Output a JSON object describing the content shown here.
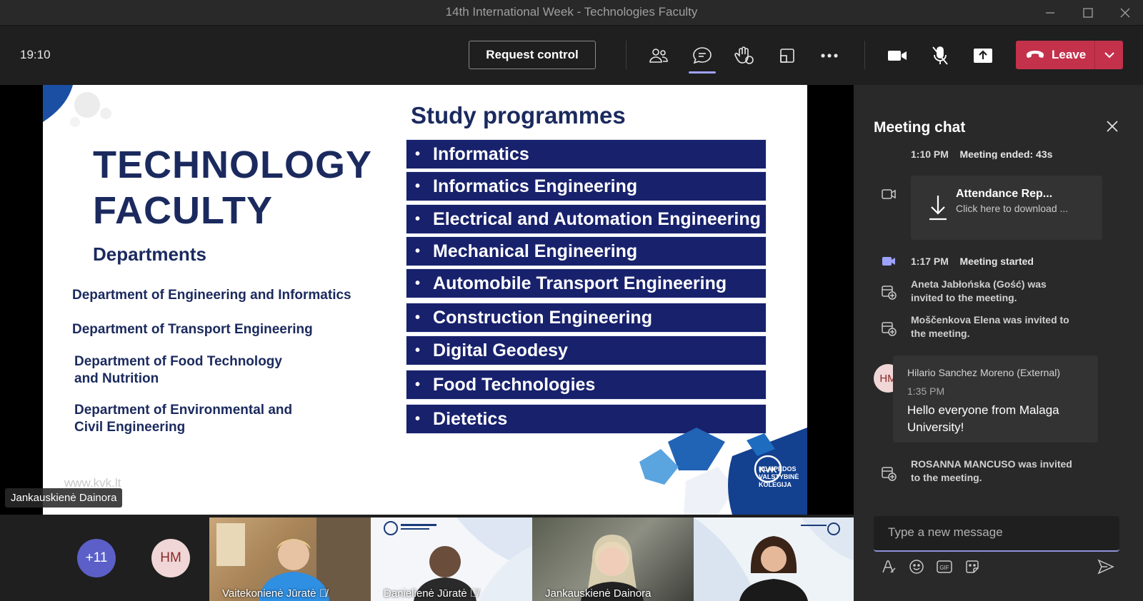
{
  "window": {
    "title": "14th International Week - Technologies Faculty"
  },
  "toolbar": {
    "clock": "19:10",
    "request_control_label": "Request control",
    "leave_label": "Leave"
  },
  "slide": {
    "title_line1": "TECHNOLOGY",
    "title_line2": "FACULTY",
    "departments_heading": "Departments",
    "departments": [
      "Department of Engineering and Informatics",
      "Department of Transport Engineering",
      "Department of Food Technology and Nutrition",
      "Department of Environmental and Civil Engineering"
    ],
    "programmes_heading": "Study programmes",
    "programmes": [
      "Informatics",
      "Informatics Engineering",
      "Electrical and Automation Engineering",
      "Mechanical Engineering",
      "Automobile Transport Engineering",
      "Construction Engineering",
      "Digital Geodesy",
      "Food Technologies",
      "Dietetics"
    ],
    "bullet": "•",
    "website": "www.kvk.lt",
    "logo_mark": "KVK",
    "logo_text": [
      "KLAIPĖDOS",
      "VALSTYBINĖ",
      "KOLEGIJA"
    ],
    "presenter_name": "Jankauskienė Dainora"
  },
  "participants": {
    "overflow_count": "+11",
    "initials_avatar": "HM",
    "tiles": [
      {
        "name": "Vaitekonienė Jūratė",
        "muted": true
      },
      {
        "name": "Danielienė Jūratė",
        "muted": true
      },
      {
        "name": "Jankauskienė Dainora",
        "muted": false
      },
      {
        "name": "",
        "muted": false
      }
    ]
  },
  "chat": {
    "title": "Meeting chat",
    "events": [
      {
        "time": "1:10 PM",
        "text": "Meeting ended: 43s"
      },
      {
        "time": "1:17 PM",
        "text": "Meeting started"
      }
    ],
    "attendance": {
      "title": "Attendance Rep...",
      "subtitle": "Click here to download ..."
    },
    "invites": [
      "Aneta Jabłońska (Gość) was invited to the meeting.",
      "Moščenkova Elena was invited to the meeting.",
      "ROSANNA MANCUSO was invited to the meeting."
    ],
    "message": {
      "initials": "HM",
      "sender": "Hilario Sanchez Moreno (External)",
      "time": "1:35 PM",
      "text": "Hello everyone from Malaga University!"
    },
    "compose_placeholder": "Type a new message"
  },
  "colors": {
    "accent": "#9ea2ff",
    "leave": "#c4314b",
    "slide_navy": "#1b2a5e",
    "programme_bar": "#18216c"
  },
  "icons": [
    "minimize-icon",
    "maximize-icon",
    "close-icon",
    "participants-icon",
    "chat-icon",
    "reactions-icon",
    "rooms-icon",
    "more-icon",
    "camera-icon",
    "mic-off-icon",
    "share-icon",
    "phone-icon",
    "chevron-down-icon",
    "download-icon",
    "format-icon",
    "emoji-icon",
    "gif-icon",
    "sticker-icon",
    "send-icon"
  ]
}
